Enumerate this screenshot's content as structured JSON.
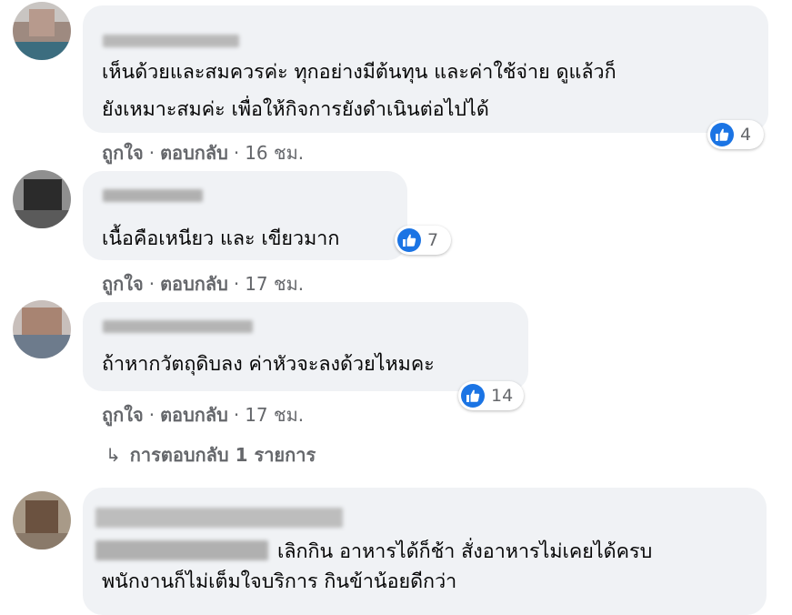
{
  "comments": [
    {
      "text_lines": [
        "เห็นด้วยและสมควรค่ะ ทุกอย่างมีต้นทุน และค่าใช้จ่าย ดูแล้วก็",
        "ยังเหมาะสมค่ะ เพื่อให้กิจการยังดำเนินต่อไปได้"
      ],
      "like_label": "ถูกใจ",
      "reply_label": "ตอบกลับ",
      "separator": "·",
      "time": "16 ชม.",
      "reaction_count": "4"
    },
    {
      "text_lines": [
        "เนื้อคือเหนียว และ เขียวมาก"
      ],
      "like_label": "ถูกใจ",
      "reply_label": "ตอบกลับ",
      "separator": "·",
      "time": "17 ชม.",
      "reaction_count": "7"
    },
    {
      "text_lines": [
        "ถ้าหากวัตถุดิบลง ค่าหัวจะลงด้วยไหมคะ"
      ],
      "like_label": "ถูกใจ",
      "reply_label": "ตอบกลับ",
      "separator": "·",
      "time": "17 ชม.",
      "reaction_count": "14",
      "replies_link": {
        "arrow": "↳",
        "label": "การตอบกลับ 1 รายการ"
      }
    },
    {
      "text_lines": [
        "เลิกกิน อาหารได้ก็ช้า สั่งอาหารไม่เคยได้ครบ",
        "พนักงานก็ไม่เต็มใจบริการ กินข้าน้อยดีกว่า"
      ]
    }
  ],
  "icons": {
    "reaction": "like-icon",
    "replies": "reply-arrow-icon"
  },
  "colors": {
    "like_blue": "#1b74e4",
    "bubble_bg": "#f0f2f5",
    "meta_text": "#65676b"
  }
}
